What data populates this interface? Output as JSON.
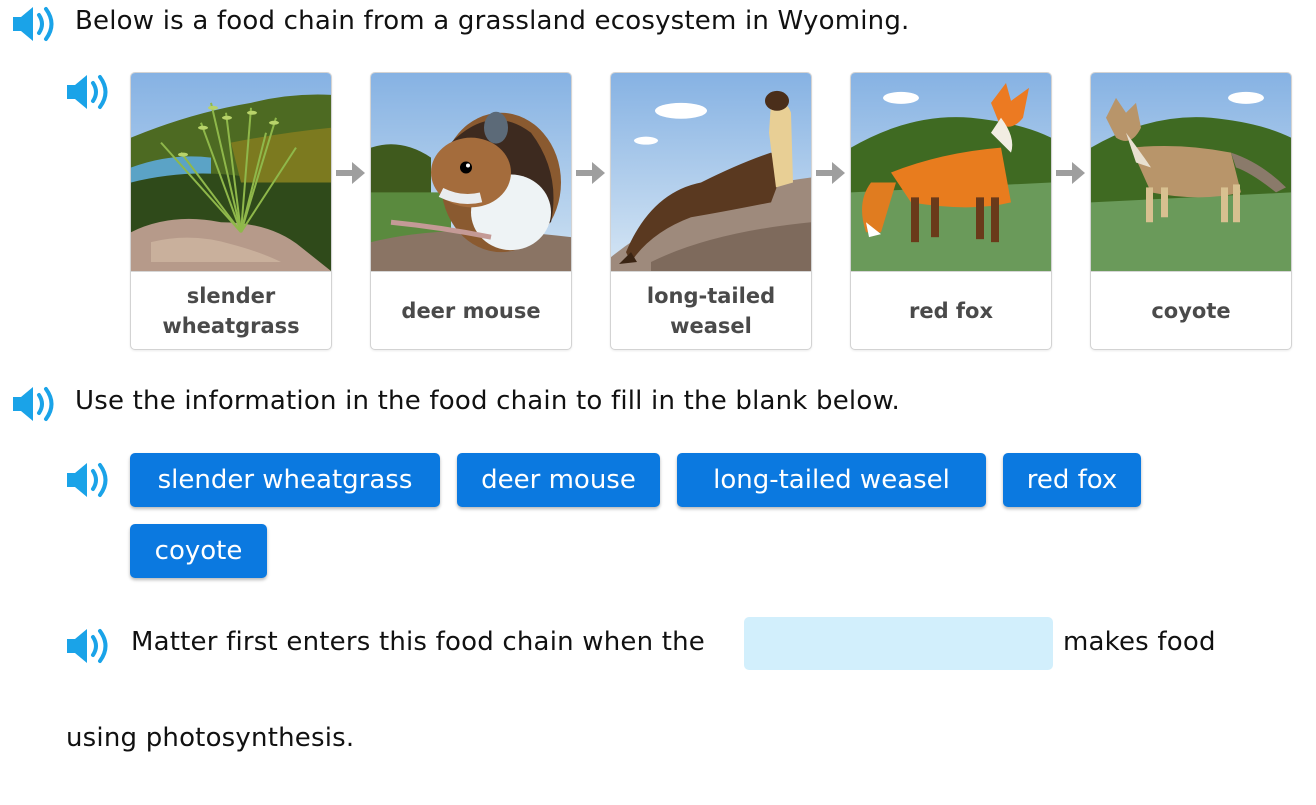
{
  "intro": {
    "text": "Below is a food chain from a grassland ecosystem in Wyoming.",
    "audio_icon": "speaker-icon"
  },
  "food_chain": {
    "audio_icon": "speaker-icon",
    "arrow_icon": "arrow-right-icon",
    "organisms": [
      {
        "label": "slender wheatgrass",
        "image": "wheatgrass-illustration"
      },
      {
        "label": "deer mouse",
        "image": "deer-mouse-illustration"
      },
      {
        "label": "long-tailed weasel",
        "image": "weasel-illustration"
      },
      {
        "label": "red fox",
        "image": "red-fox-illustration"
      },
      {
        "label": "coyote",
        "image": "coyote-illustration"
      }
    ]
  },
  "instruction": {
    "text": "Use the information in the food chain to fill in the blank below.",
    "audio_icon": "speaker-icon"
  },
  "answer_choices": {
    "audio_icon": "speaker-icon",
    "options": [
      "slender wheatgrass",
      "deer mouse",
      "long-tailed weasel",
      "red fox",
      "coyote"
    ]
  },
  "sentence": {
    "before_blank": "Matter first enters this food chain when the",
    "blank_value": "",
    "after_blank": "makes food",
    "continuation": "using photosynthesis."
  },
  "colors": {
    "accent_blue": "#0b79e0",
    "speaker_blue": "#1aa3e8",
    "blank_fill": "#d2effc",
    "card_label": "#4a4a4a",
    "arrow_gray": "#9e9e9e"
  }
}
